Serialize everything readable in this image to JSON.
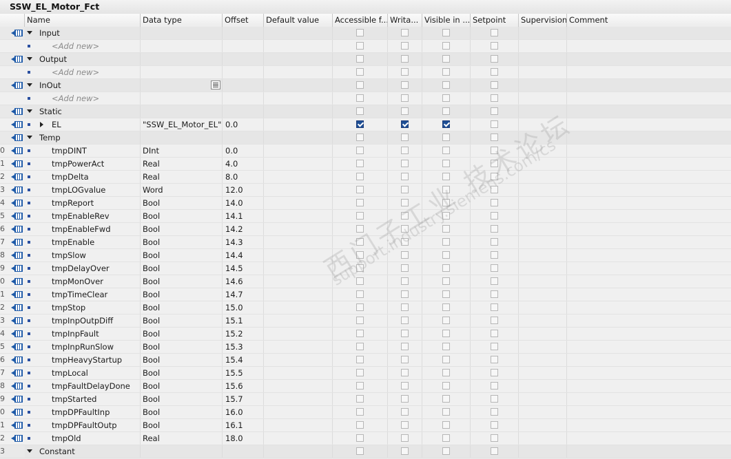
{
  "window": {
    "title": "SSW_EL_Motor_Fct"
  },
  "columns": {
    "name": "Name",
    "data_type": "Data type",
    "offset": "Offset",
    "default_value": "Default value",
    "accessible": "Accessible f...",
    "writable": "Writa...",
    "visible": "Visible in ...",
    "setpoint": "Setpoint",
    "supervision": "Supervision",
    "comment": "Comment"
  },
  "icons": {
    "interface": "interface-param-icon",
    "expand": "expand-caret-icon",
    "collapse": "collapse-caret-icon",
    "variable": "variable-bullet-icon",
    "type_picker": "type-picker-icon"
  },
  "watermark": {
    "line1": "西门子工业 技术论坛",
    "line2": "support.industry.siemens.com/cs"
  },
  "rows": [
    {
      "num": "",
      "kind": "section",
      "name": "Input",
      "type": "",
      "offset": "",
      "acc": false,
      "wri": false,
      "vis": false,
      "set": false
    },
    {
      "num": "",
      "kind": "add",
      "name": "<Add new>",
      "type": "",
      "offset": "",
      "acc": false,
      "wri": false,
      "vis": false,
      "set": false
    },
    {
      "num": "",
      "kind": "section",
      "name": "Output",
      "type": "",
      "offset": "",
      "acc": false,
      "wri": false,
      "vis": false,
      "set": false
    },
    {
      "num": "",
      "kind": "add",
      "name": "<Add new>",
      "type": "",
      "offset": "",
      "acc": false,
      "wri": false,
      "vis": false,
      "set": false
    },
    {
      "num": "",
      "kind": "section",
      "name": "InOut",
      "type": "",
      "offset": "",
      "picker": true,
      "acc": false,
      "wri": false,
      "vis": false,
      "set": false
    },
    {
      "num": "",
      "kind": "add",
      "name": "<Add new>",
      "type": "",
      "offset": "",
      "acc": false,
      "wri": false,
      "vis": false,
      "set": false
    },
    {
      "num": "",
      "kind": "section",
      "name": "Static",
      "type": "",
      "offset": "",
      "acc": false,
      "wri": false,
      "vis": false,
      "set": false
    },
    {
      "num": "",
      "kind": "struct",
      "name": "EL",
      "type": "\"SSW_EL_Motor_EL\"",
      "offset": "0.0",
      "acc": true,
      "wri": true,
      "vis": true,
      "set": false
    },
    {
      "num": "",
      "kind": "section",
      "name": "Temp",
      "type": "",
      "offset": "",
      "acc": false,
      "wri": false,
      "vis": false,
      "set": false
    },
    {
      "num": "0",
      "kind": "var",
      "name": "tmpDINT",
      "type": "DInt",
      "offset": "0.0",
      "acc": false,
      "wri": false,
      "vis": false,
      "set": false
    },
    {
      "num": "1",
      "kind": "var",
      "name": "tmpPowerAct",
      "type": "Real",
      "offset": "4.0",
      "acc": false,
      "wri": false,
      "vis": false,
      "set": false
    },
    {
      "num": "2",
      "kind": "var",
      "name": "tmpDelta",
      "type": "Real",
      "offset": "8.0",
      "acc": false,
      "wri": false,
      "vis": false,
      "set": false
    },
    {
      "num": "3",
      "kind": "var",
      "name": "tmpLOGvalue",
      "type": "Word",
      "offset": "12.0",
      "acc": false,
      "wri": false,
      "vis": false,
      "set": false
    },
    {
      "num": "4",
      "kind": "var",
      "name": "tmpReport",
      "type": "Bool",
      "offset": "14.0",
      "acc": false,
      "wri": false,
      "vis": false,
      "set": false
    },
    {
      "num": "5",
      "kind": "var",
      "name": "tmpEnableRev",
      "type": "Bool",
      "offset": "14.1",
      "acc": false,
      "wri": false,
      "vis": false,
      "set": false
    },
    {
      "num": "6",
      "kind": "var",
      "name": "tmpEnableFwd",
      "type": "Bool",
      "offset": "14.2",
      "acc": false,
      "wri": false,
      "vis": false,
      "set": false
    },
    {
      "num": "7",
      "kind": "var",
      "name": "tmpEnable",
      "type": "Bool",
      "offset": "14.3",
      "acc": false,
      "wri": false,
      "vis": false,
      "set": false
    },
    {
      "num": "8",
      "kind": "var",
      "name": "tmpSlow",
      "type": "Bool",
      "offset": "14.4",
      "acc": false,
      "wri": false,
      "vis": false,
      "set": false
    },
    {
      "num": "9",
      "kind": "var",
      "name": "tmpDelayOver",
      "type": "Bool",
      "offset": "14.5",
      "acc": false,
      "wri": false,
      "vis": false,
      "set": false
    },
    {
      "num": "0",
      "kind": "var",
      "name": "tmpMonOver",
      "type": "Bool",
      "offset": "14.6",
      "acc": false,
      "wri": false,
      "vis": false,
      "set": false
    },
    {
      "num": "1",
      "kind": "var",
      "name": "tmpTimeClear",
      "type": "Bool",
      "offset": "14.7",
      "acc": false,
      "wri": false,
      "vis": false,
      "set": false
    },
    {
      "num": "2",
      "kind": "var",
      "name": "tmpStop",
      "type": "Bool",
      "offset": "15.0",
      "acc": false,
      "wri": false,
      "vis": false,
      "set": false
    },
    {
      "num": "3",
      "kind": "var",
      "name": "tmpInpOutpDiff",
      "type": "Bool",
      "offset": "15.1",
      "acc": false,
      "wri": false,
      "vis": false,
      "set": false
    },
    {
      "num": "4",
      "kind": "var",
      "name": "tmpInpFault",
      "type": "Bool",
      "offset": "15.2",
      "acc": false,
      "wri": false,
      "vis": false,
      "set": false
    },
    {
      "num": "5",
      "kind": "var",
      "name": "tmpInpRunSlow",
      "type": "Bool",
      "offset": "15.3",
      "acc": false,
      "wri": false,
      "vis": false,
      "set": false
    },
    {
      "num": "6",
      "kind": "var",
      "name": "tmpHeavyStartup",
      "type": "Bool",
      "offset": "15.4",
      "acc": false,
      "wri": false,
      "vis": false,
      "set": false
    },
    {
      "num": "7",
      "kind": "var",
      "name": "tmpLocal",
      "type": "Bool",
      "offset": "15.5",
      "acc": false,
      "wri": false,
      "vis": false,
      "set": false
    },
    {
      "num": "8",
      "kind": "var",
      "name": "tmpFaultDelayDone",
      "type": "Bool",
      "offset": "15.6",
      "acc": false,
      "wri": false,
      "vis": false,
      "set": false
    },
    {
      "num": "9",
      "kind": "var",
      "name": "tmpStarted",
      "type": "Bool",
      "offset": "15.7",
      "acc": false,
      "wri": false,
      "vis": false,
      "set": false
    },
    {
      "num": "0",
      "kind": "var",
      "name": "tmpDPFaultInp",
      "type": "Bool",
      "offset": "16.0",
      "acc": false,
      "wri": false,
      "vis": false,
      "set": false
    },
    {
      "num": "1",
      "kind": "var",
      "name": "tmpDPFaultOutp",
      "type": "Bool",
      "offset": "16.1",
      "acc": false,
      "wri": false,
      "vis": false,
      "set": false
    },
    {
      "num": "2",
      "kind": "var",
      "name": "tmpOld",
      "type": "Real",
      "offset": "18.0",
      "acc": false,
      "wri": false,
      "vis": false,
      "set": false
    },
    {
      "num": "3",
      "kind": "section-noicon",
      "name": "Constant",
      "type": "",
      "offset": "",
      "acc": false,
      "wri": false,
      "vis": false,
      "set": false
    }
  ]
}
